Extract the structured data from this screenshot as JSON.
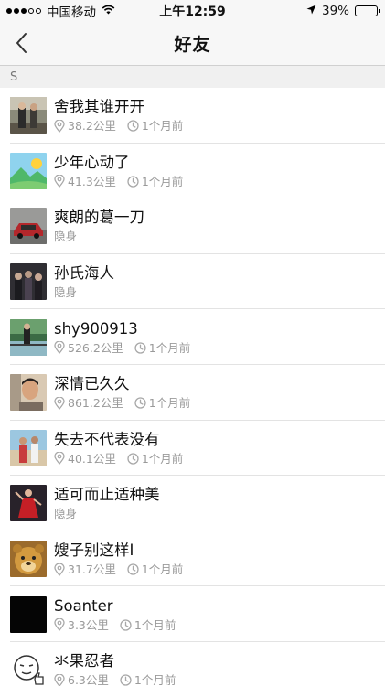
{
  "status": {
    "carrier": "中国移动",
    "time": "上午12:59",
    "battery": "39%",
    "battery_level": 0.39
  },
  "nav": {
    "title": "好友"
  },
  "section": {
    "letter": "S"
  },
  "friends": [
    {
      "name": "舍我其谁开开",
      "distance": "38.2公里",
      "time": "1个月前",
      "avatar": "photo-two-people"
    },
    {
      "name": "少年心动了",
      "distance": "41.3公里",
      "time": "1个月前",
      "avatar": "cartoon-landscape"
    },
    {
      "name": "爽朗的葛一刀",
      "hidden": "隐身",
      "avatar": "photo-car"
    },
    {
      "name": "孙氏海人",
      "hidden": "隐身",
      "avatar": "photo-group-dark"
    },
    {
      "name": "shy900913",
      "distance": "526.2公里",
      "time": "1个月前",
      "avatar": "photo-lake"
    },
    {
      "name": "深情已久久",
      "distance": "861.2公里",
      "time": "1个月前",
      "avatar": "photo-man-portrait"
    },
    {
      "name": "失去不代表没有",
      "distance": "40.1公里",
      "time": "1个月前",
      "avatar": "photo-beach-couple"
    },
    {
      "name": "适可而止适种美",
      "hidden": "隐身",
      "avatar": "photo-dancer-red"
    },
    {
      "name": "嫂子别这样I",
      "distance": "31.7公里",
      "time": "1个月前",
      "avatar": "cartoon-bear"
    },
    {
      "name": "Soanter",
      "distance": "3.3公里",
      "time": "1个月前",
      "avatar": "black-square"
    },
    {
      "name": "氺果忍者",
      "distance": "6.3公里",
      "time": "1个月前",
      "avatar": "sketch-face-thumbsup"
    }
  ]
}
